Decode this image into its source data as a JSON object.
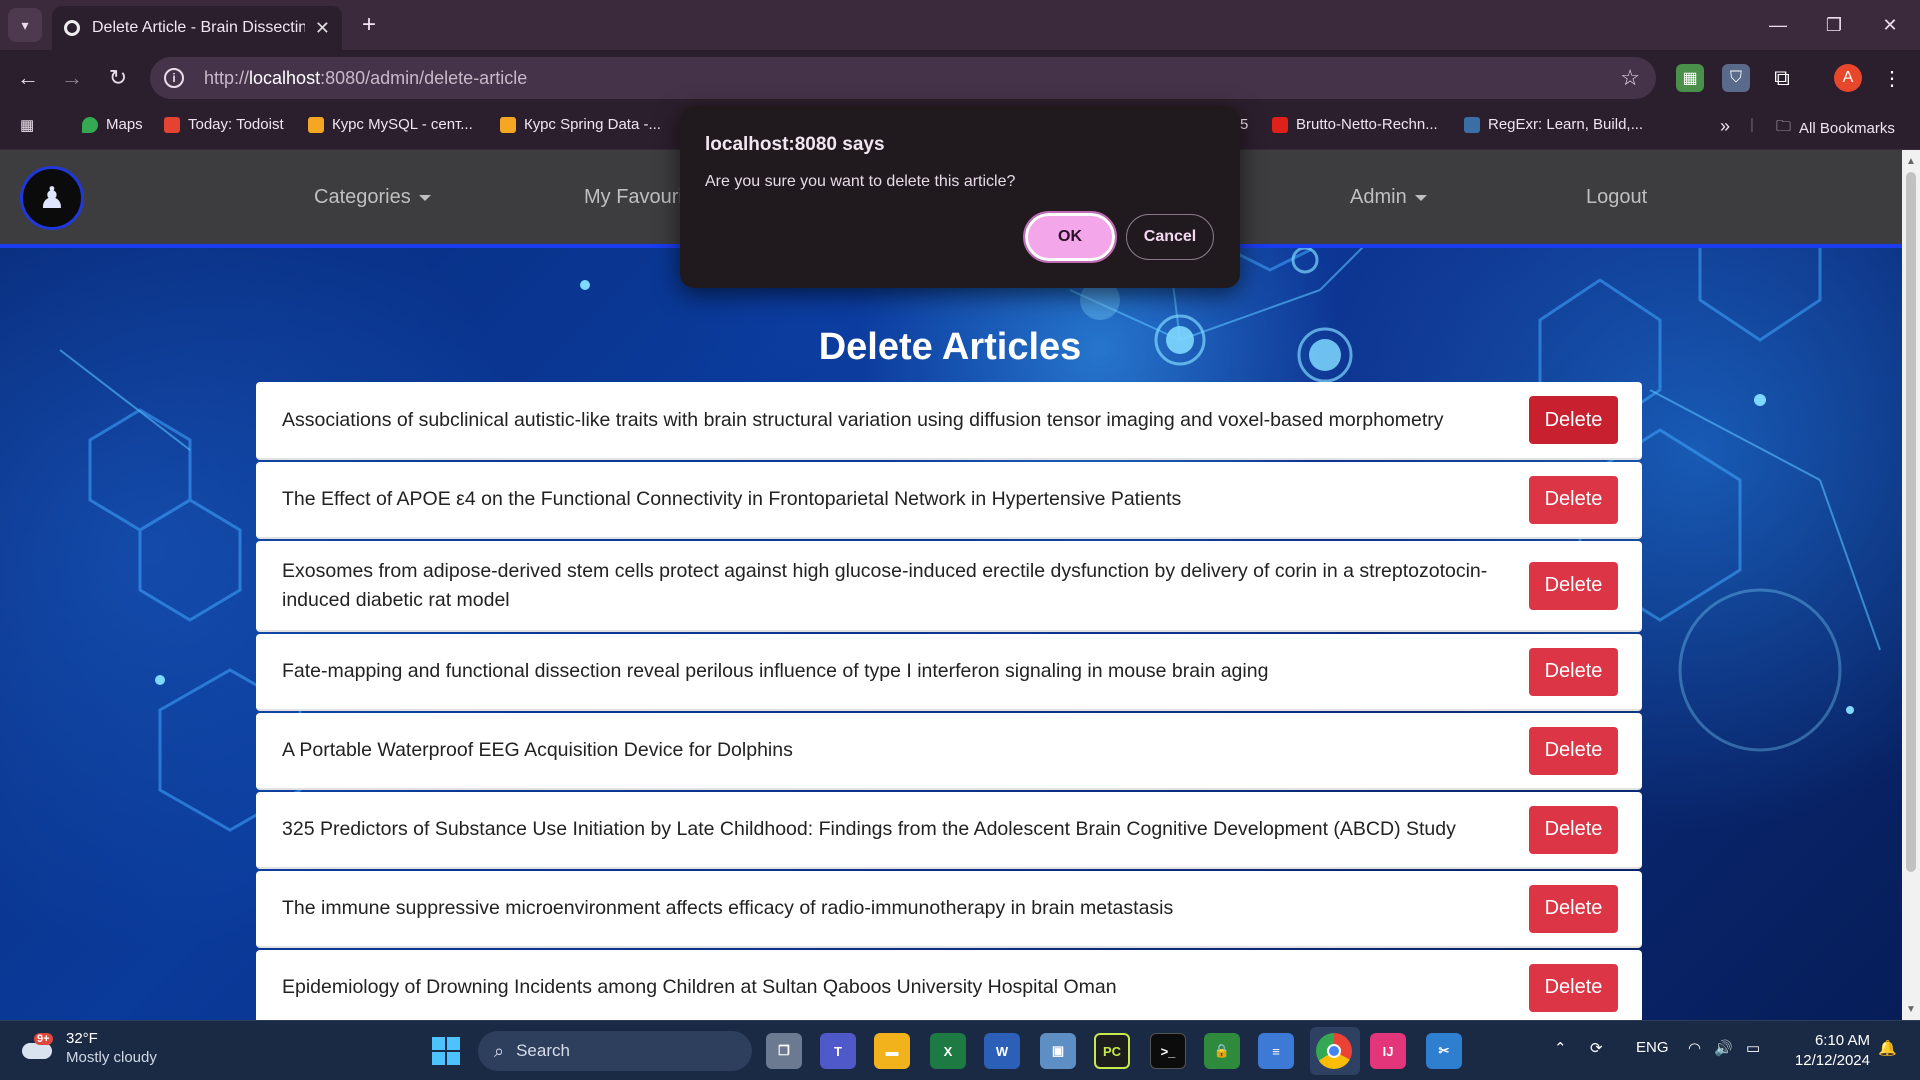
{
  "browser": {
    "tab_title": "Delete Article - Brain Dissecting",
    "url_host": "localhost",
    "url_prefix": "http://",
    "url_rest": ":8080/admin/delete-article",
    "bookmarks": [
      {
        "label": "Maps",
        "color": "#34a853"
      },
      {
        "label": "Today: Todoist",
        "color": "#e44332"
      },
      {
        "label": "Курс MySQL - сеnт...",
        "color": "#f5a623"
      },
      {
        "label": "Курс Spring Data -...",
        "color": "#f5a623"
      },
      {
        "label": "5",
        "color": "#2c1f2d"
      },
      {
        "label": "Brutto-Netto-Rechn...",
        "color": "#e0201b"
      },
      {
        "label": "RegExr: Learn, Build,...",
        "color": "#3a6ea5"
      }
    ],
    "all_bookmarks": "All Bookmarks",
    "profile_initial": "A"
  },
  "nav": {
    "categories": "Categories",
    "favourites": "My Favouri",
    "admin": "Admin",
    "logout": "Logout"
  },
  "page": {
    "title": "Delete Articles",
    "delete_label": "Delete",
    "articles": [
      "Associations of subclinical autistic-like traits with brain structural variation using diffusion tensor imaging and voxel-based morphometry",
      "The Effect of APOE ε4 on the Functional Connectivity in Frontoparietal Network in Hypertensive Patients",
      "Exosomes from adipose-derived stem cells protect against high glucose-induced erectile dysfunction by delivery of corin in a streptozotocin-induced diabetic rat model",
      "Fate-mapping and functional dissection reveal perilous influence of type I interferon signaling in mouse brain aging",
      "A Portable Waterproof EEG Acquisition Device for Dolphins",
      "325 Predictors of Substance Use Initiation by Late Childhood: Findings from the Adolescent Brain Cognitive Development (ABCD) Study",
      "The immune suppressive microenvironment affects efficacy of radio-immunotherapy in brain metastasis",
      "Epidemiology of Drowning Incidents among Children at Sultan Qaboos University Hospital Oman"
    ]
  },
  "dialog": {
    "title": "localhost:8080 says",
    "message": "Are you sure you want to delete this article?",
    "ok": "OK",
    "cancel": "Cancel"
  },
  "taskbar": {
    "weather_badge": "9+",
    "temperature": "32°F",
    "condition": "Mostly cloudy",
    "search": "Search",
    "language": "ENG",
    "time": "6:10 AM",
    "date": "12/12/2024"
  },
  "colors": {
    "delete_button": "#dc3545",
    "nav_bar": "#3d3d3f",
    "nav_accent": "#1b3cf0",
    "dialog_ok": "#f3a6ea"
  }
}
